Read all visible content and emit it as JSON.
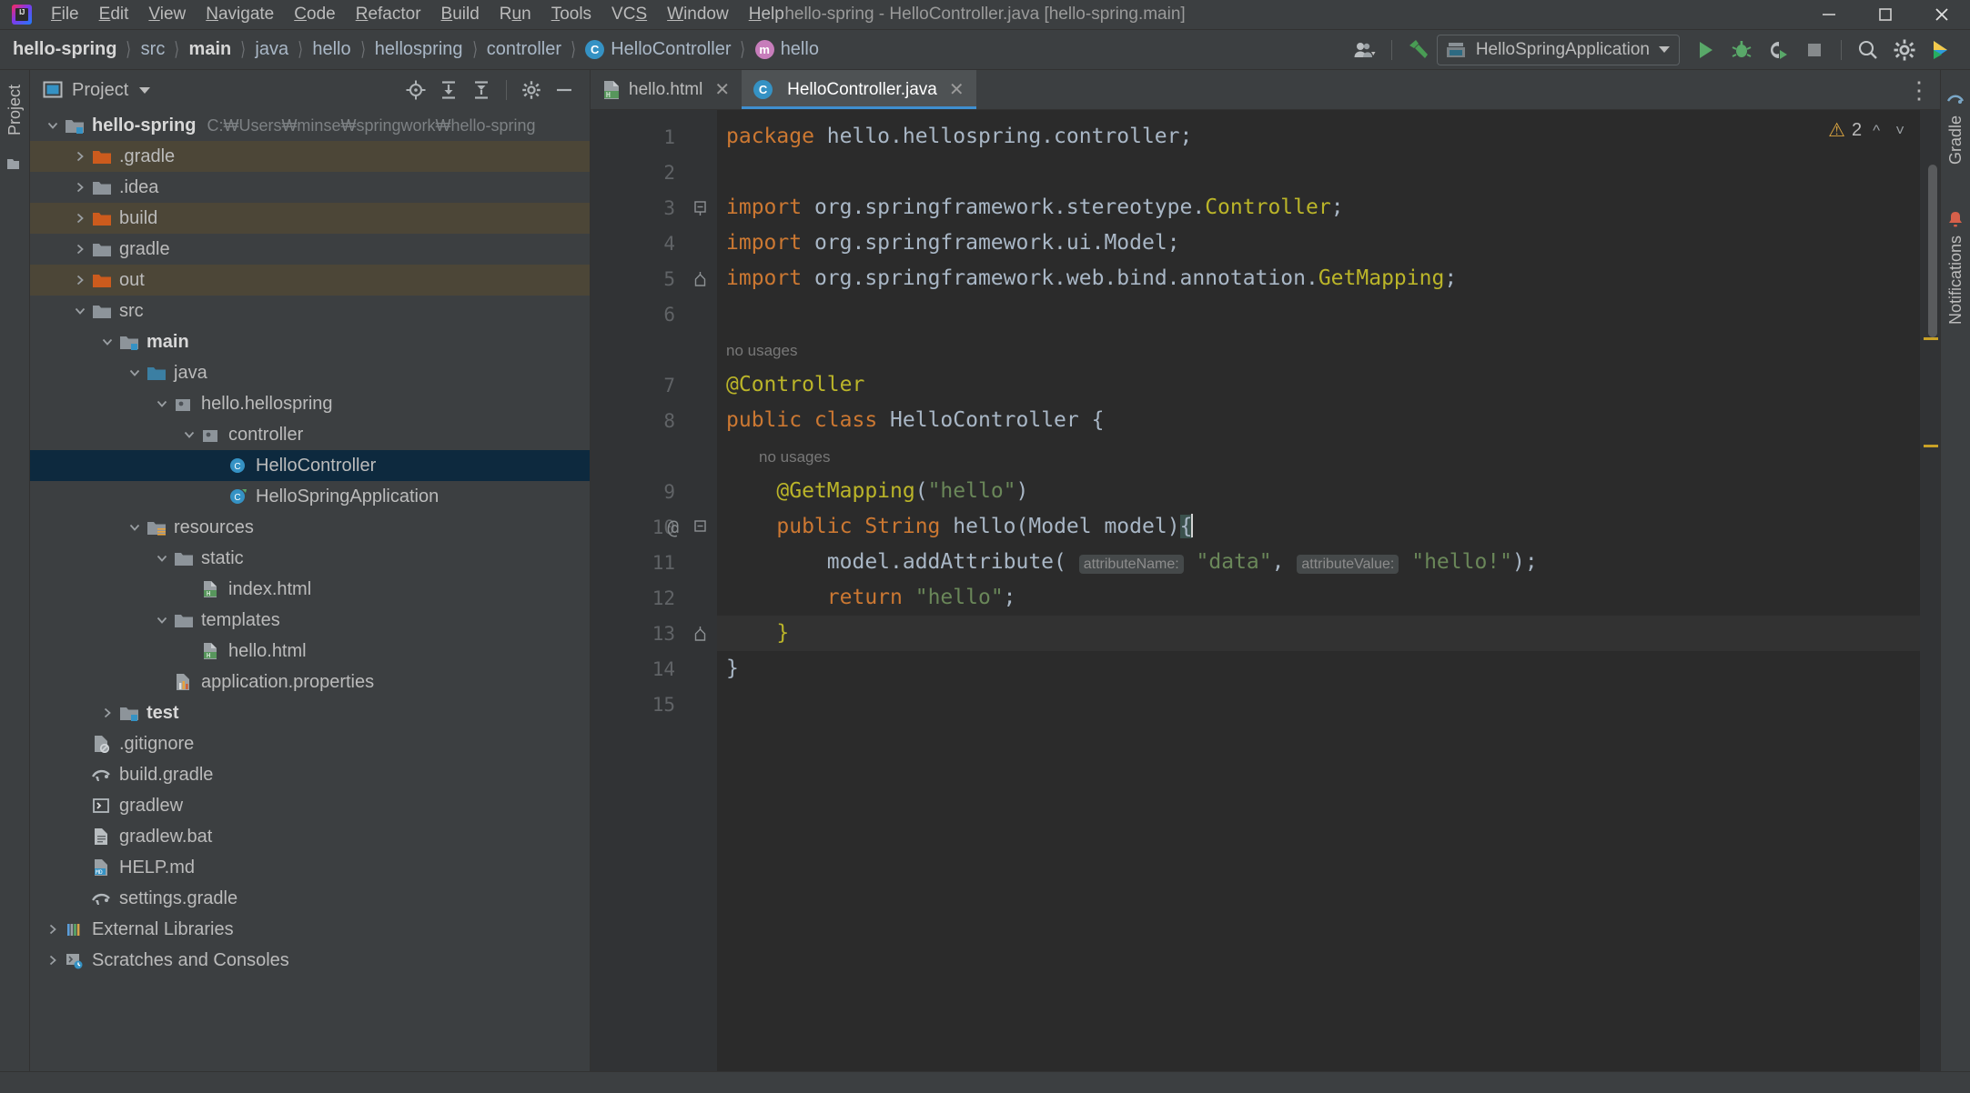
{
  "window": {
    "title": "hello-spring - HelloController.java [hello-spring.main]",
    "logo_text": "IJ",
    "minimize_label": "Minimize",
    "maximize_label": "Maximize",
    "close_label": "Close"
  },
  "menu": [
    {
      "label": "File",
      "mnemonic": "F"
    },
    {
      "label": "Edit",
      "mnemonic": "E"
    },
    {
      "label": "View",
      "mnemonic": "V"
    },
    {
      "label": "Navigate",
      "mnemonic": "N"
    },
    {
      "label": "Code",
      "mnemonic": "C"
    },
    {
      "label": "Refactor",
      "mnemonic": "R"
    },
    {
      "label": "Build",
      "mnemonic": "B"
    },
    {
      "label": "Run",
      "mnemonic": "u"
    },
    {
      "label": "Tools",
      "mnemonic": "T"
    },
    {
      "label": "VCS",
      "mnemonic": "S"
    },
    {
      "label": "Window",
      "mnemonic": "W"
    },
    {
      "label": "Help",
      "mnemonic": "H"
    }
  ],
  "breadcrumbs": [
    {
      "label": "hello-spring",
      "bold": true,
      "icon": ""
    },
    {
      "label": "src",
      "bold": false,
      "icon": ""
    },
    {
      "label": "main",
      "bold": true,
      "icon": ""
    },
    {
      "label": "java",
      "bold": false,
      "icon": ""
    },
    {
      "label": "hello",
      "bold": false,
      "icon": ""
    },
    {
      "label": "hellospring",
      "bold": false,
      "icon": ""
    },
    {
      "label": "controller",
      "bold": false,
      "icon": ""
    },
    {
      "label": "HelloController",
      "bold": false,
      "icon": "C"
    },
    {
      "label": "hello",
      "bold": false,
      "icon": "m"
    }
  ],
  "toolbar": {
    "run_config": "HelloSpringApplication",
    "icons": [
      "user-account-icon",
      "hammer-build-icon",
      "run-icon",
      "debug-icon",
      "run-with-coverage-icon",
      "stop-icon",
      "search-everywhere-icon",
      "settings-gear-icon",
      "ide-assistant-icon"
    ]
  },
  "left_strip": {
    "tab_label": "Project",
    "icon": "structure-icon"
  },
  "right_strip": {
    "gradle_label": "Gradle",
    "notifications_label": "Notifications"
  },
  "project_panel": {
    "title": "Project",
    "header_icons": [
      "locate-icon",
      "expand-all-icon",
      "collapse-all-icon",
      "settings-gear-icon",
      "hide-icon"
    ],
    "tree": [
      {
        "label": "hello-spring",
        "path": "C:\\Users\\minse\\springwork\\hello-spring",
        "depth": 0,
        "arrow": "down",
        "icon": "module-folder-icon",
        "bold": true,
        "state": "normal"
      },
      {
        "label": ".gradle",
        "path": "",
        "depth": 1,
        "arrow": "right",
        "icon": "excluded-folder-icon",
        "bold": false,
        "state": "tan"
      },
      {
        "label": ".idea",
        "path": "",
        "depth": 1,
        "arrow": "right",
        "icon": "folder-icon",
        "bold": false,
        "state": "normal"
      },
      {
        "label": "build",
        "path": "",
        "depth": 1,
        "arrow": "right",
        "icon": "excluded-folder-icon",
        "bold": false,
        "state": "tan"
      },
      {
        "label": "gradle",
        "path": "",
        "depth": 1,
        "arrow": "right",
        "icon": "folder-icon",
        "bold": false,
        "state": "normal"
      },
      {
        "label": "out",
        "path": "",
        "depth": 1,
        "arrow": "right",
        "icon": "excluded-folder-icon",
        "bold": false,
        "state": "tan"
      },
      {
        "label": "src",
        "path": "",
        "depth": 1,
        "arrow": "down",
        "icon": "folder-icon",
        "bold": false,
        "state": "normal"
      },
      {
        "label": "main",
        "path": "",
        "depth": 2,
        "arrow": "down",
        "icon": "module-folder-icon",
        "bold": true,
        "state": "normal"
      },
      {
        "label": "java",
        "path": "",
        "depth": 3,
        "arrow": "down",
        "icon": "source-folder-icon",
        "bold": false,
        "state": "normal"
      },
      {
        "label": "hello.hellospring",
        "path": "",
        "depth": 4,
        "arrow": "down",
        "icon": "package-icon",
        "bold": false,
        "state": "normal"
      },
      {
        "label": "controller",
        "path": "",
        "depth": 5,
        "arrow": "down",
        "icon": "package-icon",
        "bold": false,
        "state": "normal"
      },
      {
        "label": "HelloController",
        "path": "",
        "depth": 6,
        "arrow": "none",
        "icon": "java-class-icon",
        "bold": false,
        "state": "selected"
      },
      {
        "label": "HelloSpringApplication",
        "path": "",
        "depth": 6,
        "arrow": "none",
        "icon": "spring-class-icon",
        "bold": false,
        "state": "normal"
      },
      {
        "label": "resources",
        "path": "",
        "depth": 3,
        "arrow": "down",
        "icon": "resources-folder-icon",
        "bold": false,
        "state": "normal"
      },
      {
        "label": "static",
        "path": "",
        "depth": 4,
        "arrow": "down",
        "icon": "folder-icon",
        "bold": false,
        "state": "normal"
      },
      {
        "label": "index.html",
        "path": "",
        "depth": 5,
        "arrow": "none",
        "icon": "html-file-icon",
        "bold": false,
        "state": "normal"
      },
      {
        "label": "templates",
        "path": "",
        "depth": 4,
        "arrow": "down",
        "icon": "folder-icon",
        "bold": false,
        "state": "normal"
      },
      {
        "label": "hello.html",
        "path": "",
        "depth": 5,
        "arrow": "none",
        "icon": "html-file-icon",
        "bold": false,
        "state": "normal"
      },
      {
        "label": "application.properties",
        "path": "",
        "depth": 4,
        "arrow": "none",
        "icon": "properties-file-icon",
        "bold": false,
        "state": "normal"
      },
      {
        "label": "test",
        "path": "",
        "depth": 2,
        "arrow": "right",
        "icon": "test-module-folder-icon",
        "bold": true,
        "state": "normal"
      },
      {
        "label": ".gitignore",
        "path": "",
        "depth": 1,
        "arrow": "none",
        "icon": "gitignore-file-icon",
        "bold": false,
        "state": "normal"
      },
      {
        "label": "build.gradle",
        "path": "",
        "depth": 1,
        "arrow": "none",
        "icon": "gradle-file-icon",
        "bold": false,
        "state": "normal"
      },
      {
        "label": "gradlew",
        "path": "",
        "depth": 1,
        "arrow": "none",
        "icon": "shell-script-icon",
        "bold": false,
        "state": "normal"
      },
      {
        "label": "gradlew.bat",
        "path": "",
        "depth": 1,
        "arrow": "none",
        "icon": "batch-file-icon",
        "bold": false,
        "state": "normal"
      },
      {
        "label": "HELP.md",
        "path": "",
        "depth": 1,
        "arrow": "none",
        "icon": "markdown-file-icon",
        "bold": false,
        "state": "normal"
      },
      {
        "label": "settings.gradle",
        "path": "",
        "depth": 1,
        "arrow": "none",
        "icon": "gradle-file-icon",
        "bold": false,
        "state": "normal"
      },
      {
        "label": "External Libraries",
        "path": "",
        "depth": 0,
        "arrow": "right",
        "icon": "libraries-icon",
        "bold": false,
        "state": "normal"
      },
      {
        "label": "Scratches and Consoles",
        "path": "",
        "depth": 0,
        "arrow": "right",
        "icon": "scratches-icon",
        "bold": false,
        "state": "normal"
      }
    ]
  },
  "editor": {
    "tabs": [
      {
        "label": "hello.html",
        "icon": "html-file-icon",
        "active": false
      },
      {
        "label": "HelloController.java",
        "icon": "java-class-icon",
        "active": true
      }
    ],
    "more_actions_label": "⋮",
    "inspection": {
      "warning_count": "2",
      "warning_icon": "warning-triangle-icon",
      "prev_icon": "chevron-up-icon",
      "next_icon": "chevron-down-icon"
    },
    "line_numbers": [
      "1",
      "2",
      "3",
      "4",
      "5",
      "6",
      "7",
      "8",
      "9",
      "10",
      "11",
      "12",
      "13",
      "14",
      "15"
    ],
    "gutter_annotation": "@",
    "hints": [
      {
        "text": "no usages",
        "after_line": 6
      },
      {
        "text": "no usages",
        "after_line": 8
      }
    ],
    "code_lines": [
      {
        "n": 1,
        "text": "package hello.hellospring.controller;"
      },
      {
        "n": 2,
        "text": ""
      },
      {
        "n": 3,
        "text": "import org.springframework.stereotype.Controller;"
      },
      {
        "n": 4,
        "text": "import org.springframework.ui.Model;"
      },
      {
        "n": 5,
        "text": "import org.springframework.web.bind.annotation.GetMapping;"
      },
      {
        "n": 6,
        "text": ""
      },
      {
        "n": 7,
        "text": "@Controller"
      },
      {
        "n": 8,
        "text": "public class HelloController {"
      },
      {
        "n": 9,
        "text": "    @GetMapping(\"hello\")"
      },
      {
        "n": 10,
        "text": "    public String hello(Model model){"
      },
      {
        "n": 11,
        "text": "        model.addAttribute( attributeName: \"data\", attributeValue: \"hello!\");"
      },
      {
        "n": 12,
        "text": "        return \"hello\";"
      },
      {
        "n": 13,
        "text": "    }"
      },
      {
        "n": 14,
        "text": "}"
      },
      {
        "n": 15,
        "text": ""
      }
    ],
    "tokens": {
      "kw_package": "package",
      "pkg_name": " hello.hellospring.controller;",
      "kw_import": "import",
      "imp1_path": " org.springframework.stereotype.",
      "imp1_cls": "Controller",
      "imp2_path": " org.springframework.ui.",
      "imp2_cls": "Model",
      "imp3_path": " org.springframework.web.bind.annotation.",
      "imp3_cls": "GetMapping",
      "anno_controller": "@Controller",
      "kw_public": "public",
      "kw_class": "class",
      "class_name": "HelloController",
      "brace_open": "{",
      "anno_getmapping": "@GetMapping",
      "getmapping_str": "\"hello\"",
      "kw_string": "String",
      "method_name": "hello",
      "param_type": "Model",
      "param_name": "model",
      "call_obj": "model",
      "call_method": ".addAttribute",
      "inlay_name": "attributeName:",
      "arg_data": "\"data\"",
      "inlay_value": "attributeValue:",
      "arg_hello": "\"hello!\"",
      "kw_return": "return",
      "return_str": "\"hello\"",
      "brace_close": "}",
      "semicolon": ";",
      "paren_open": "(",
      "paren_close": ")",
      "comma": ","
    }
  }
}
